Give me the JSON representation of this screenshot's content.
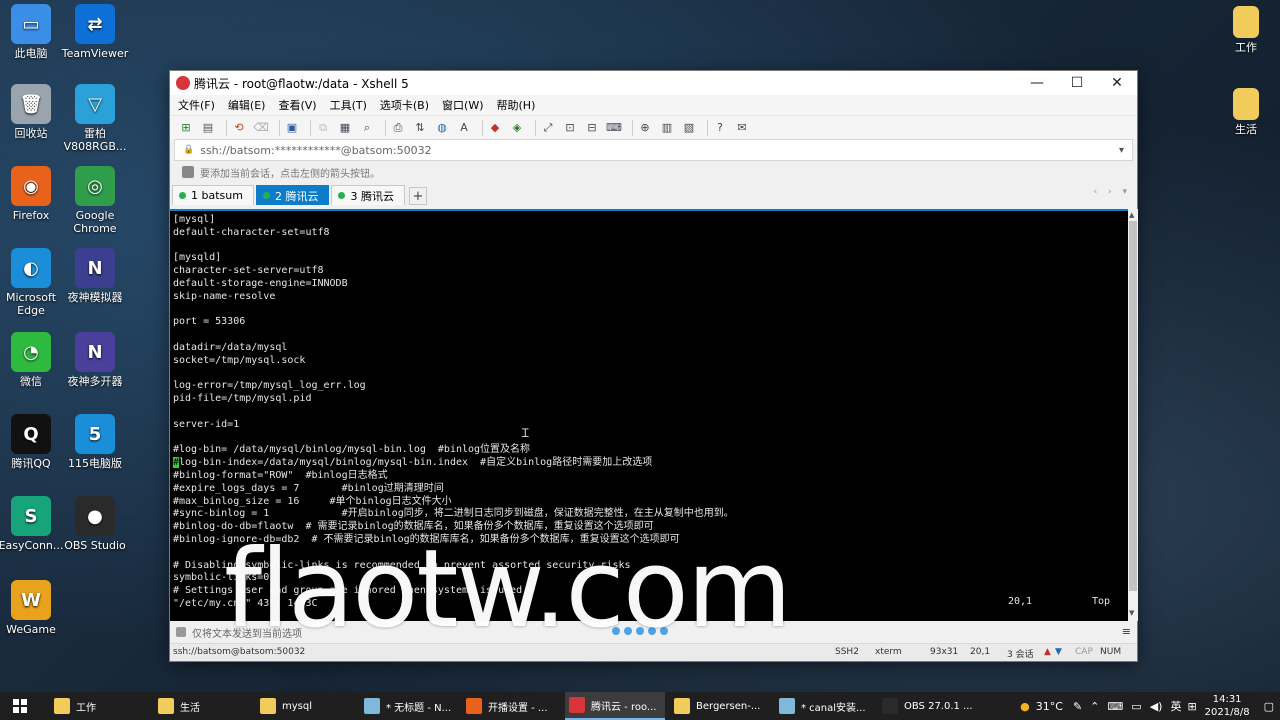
{
  "desktop": {
    "left_icons": [
      {
        "label": "此电脑",
        "color": "#3a8ee6",
        "glyph": "▭",
        "icon": "computer-icon"
      },
      {
        "label": "TeamViewer",
        "color": "#0e6fd6",
        "glyph": "⇄",
        "icon": "teamviewer-icon"
      },
      {
        "label": "回收站",
        "color": "#9aa4ad",
        "glyph": "🗑",
        "icon": "recycle-bin-icon"
      },
      {
        "label": "雷柏\nV808RGB...",
        "color": "#2aa1d8",
        "glyph": "▽",
        "icon": "rapoo-icon"
      },
      {
        "label": "Firefox",
        "color": "#e8621b",
        "glyph": "◉",
        "icon": "firefox-icon"
      },
      {
        "label": "Google\nChrome",
        "color": "#2f9d4a",
        "glyph": "◎",
        "icon": "chrome-icon"
      },
      {
        "label": "Microsoft\nEdge",
        "color": "#1a8ed8",
        "glyph": "◐",
        "icon": "edge-icon"
      },
      {
        "label": "夜神模拟器",
        "color": "#3c3f8f",
        "glyph": "N",
        "icon": "nox-icon"
      },
      {
        "label": "微信",
        "color": "#2dba3f",
        "glyph": "◔",
        "icon": "wechat-icon"
      },
      {
        "label": "夜神多开器",
        "color": "#4a3f9a",
        "glyph": "N",
        "icon": "nox-multi-icon"
      },
      {
        "label": "腾讯QQ",
        "color": "#111111",
        "glyph": "Q",
        "icon": "qq-icon"
      },
      {
        "label": "115电脑版",
        "color": "#1a8ed8",
        "glyph": "5",
        "icon": "115-icon"
      },
      {
        "label": "EasyConn...",
        "color": "#17a47a",
        "glyph": "S",
        "icon": "easyconnect-icon"
      },
      {
        "label": "OBS Studio",
        "color": "#2a2a2a",
        "glyph": "●",
        "icon": "obs-icon"
      },
      {
        "label": "WeGame",
        "color": "#e8a21b",
        "glyph": "W",
        "icon": "wegame-icon"
      }
    ],
    "right_icons": [
      {
        "label": "工作",
        "color": "#f2cc5a",
        "icon": "folder-work-icon"
      },
      {
        "label": "生活",
        "color": "#f2cc5a",
        "icon": "folder-life-icon"
      }
    ]
  },
  "window": {
    "title": "腾讯云 - root@flaotw:/data - Xshell 5",
    "menu": [
      "文件(F)",
      "编辑(E)",
      "查看(V)",
      "工具(T)",
      "选项卡(B)",
      "窗口(W)",
      "帮助(H)"
    ],
    "address": "ssh://batsom:************@batsom:50032",
    "hint": "要添加当前会话，点击左侧的箭头按钮。",
    "tabs": [
      {
        "label": "1 batsum",
        "active": false
      },
      {
        "label": "2 腾讯云",
        "active": true
      },
      {
        "label": "3 腾讯云",
        "active": false
      }
    ],
    "tab_add": "+",
    "tab_nav": "‹ › ▾"
  },
  "terminal": {
    "lines": [
      "[mysql]",
      "default-character-set=utf8",
      "",
      "[mysqld]",
      "character-set-server=utf8",
      "default-storage-engine=INNODB",
      "skip-name-resolve",
      "",
      "port = 53306",
      "",
      "datadir=/data/mysql",
      "socket=/tmp/mysql.sock",
      "",
      "log-error=/tmp/mysql_log_err.log",
      "pid-file=/tmp/mysql.pid",
      "",
      "server-id=1",
      "",
      "#log-bin= /data/mysql/binlog/mysql-bin.log  #binlog位置及名称",
      "#log-bin-index=/data/mysql/binlog/mysql-bin.index  #自定义binlog路径时需要加上改选项",
      "#binlog-format=\"ROW\"  #binlog日志格式",
      "#expire_logs_days = 7       #binlog过期清理时间",
      "#max_binlog_size = 16     #单个binlog日志文件大小",
      "#sync-binlog = 1            #开启binlog同步，将二进制日志同步到磁盘，保证数据完整性，在主从复制中也用到。",
      "#binlog-do-db=flaotw  # 需要记录binlog的数据库名，如果备份多个数据库，重复设置这个选项即可",
      "#binlog-ignore-db=db2  # 不需要记录binlog的数据库库名，如果备份多个数据库，重复设置这个选项即可",
      "",
      "# Disabling symbolic-links is recommended to prevent assorted security risks",
      "symbolic-links=0",
      "# Settings user and group are ignored when systemd is used.",
      "\"/etc/my.cnf\" 43L, 1443C"
    ],
    "cursor_line": 19,
    "position": "20,1",
    "scroll": "Top"
  },
  "compose": {
    "label": "仅将文本发送到当前选项",
    "menu_glyph": "≡"
  },
  "statusbar": {
    "conn": "ssh://batsom@batsom:50032",
    "proto": "SSH2",
    "term": "xterm",
    "size": "93x31",
    "cursor": "20,1",
    "sessions": "3 会话",
    "caps": "CAP",
    "num": "NUM"
  },
  "watermark": "flaotw.com",
  "taskbar": {
    "items": [
      {
        "label": "工作",
        "color": "#f2cc5a"
      },
      {
        "label": "生活",
        "color": "#f2cc5a"
      },
      {
        "label": "mysql",
        "color": "#f2cc5a"
      },
      {
        "label": "* 无标题 - N...",
        "color": "#7fb8d8"
      },
      {
        "label": "开播设置 - ...",
        "color": "#e8621b"
      },
      {
        "label": "腾讯云 - roo...",
        "color": "#d9343a"
      },
      {
        "label": "Bergersen-...",
        "color": "#f2cc5a"
      },
      {
        "label": "* canal安装...",
        "color": "#7fb8d8"
      },
      {
        "label": "OBS 27.0.1 ...",
        "color": "#2a2a2a"
      }
    ],
    "weather": "31°C",
    "ime": "英",
    "time": "14:31",
    "date": "2021/8/8"
  }
}
